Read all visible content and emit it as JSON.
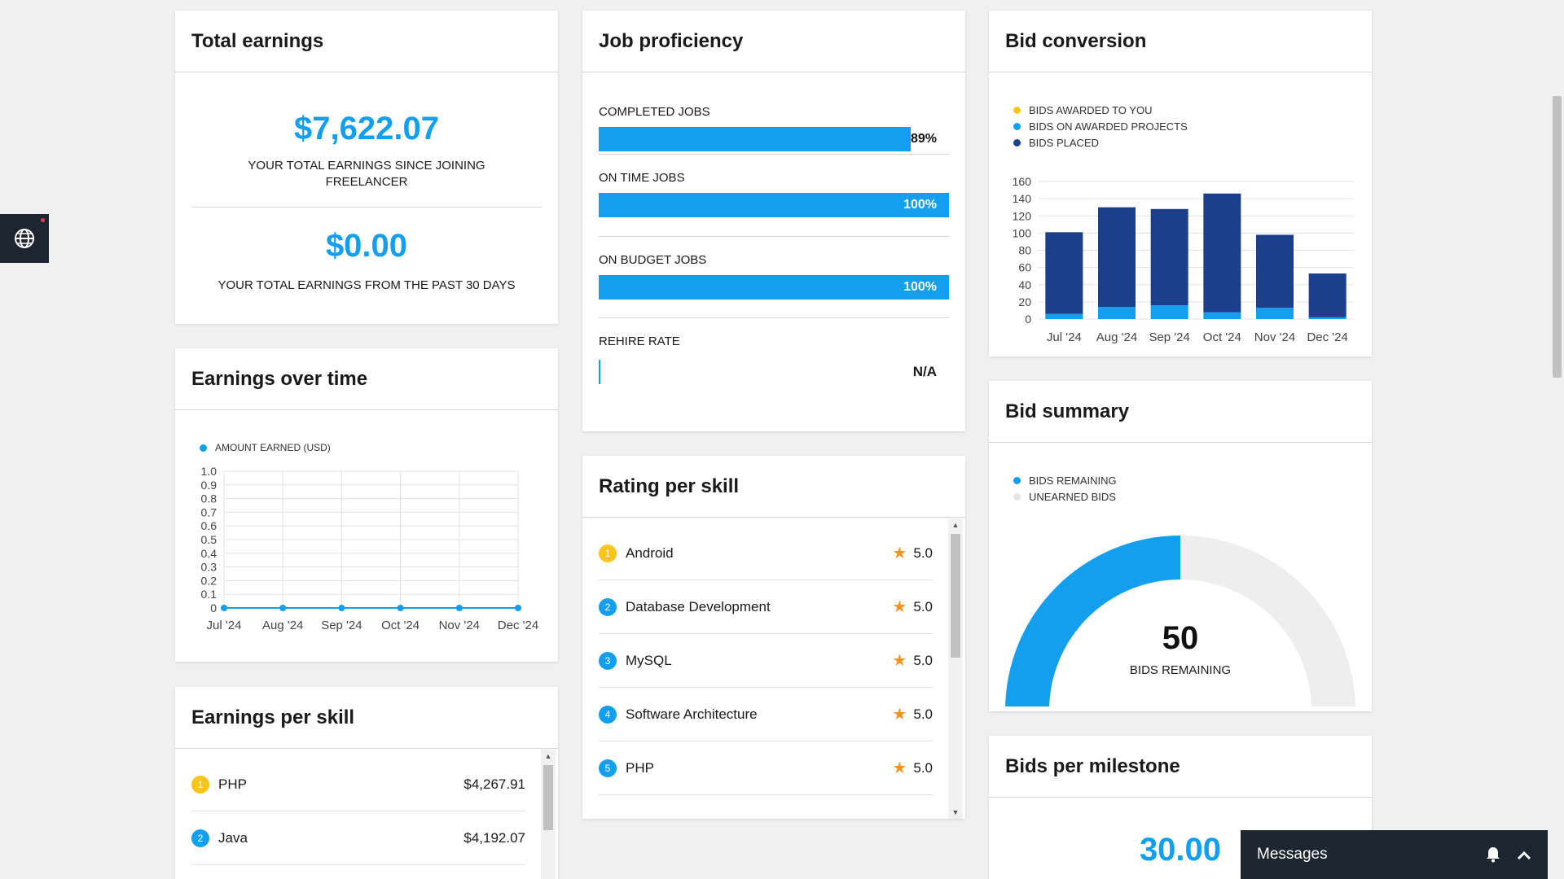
{
  "total_earnings": {
    "title": "Total earnings",
    "amount": "$7,622.07",
    "amount_caption_line1": "YOUR TOTAL EARNINGS SINCE JOINING",
    "amount_caption_line2": "FREELANCER",
    "recent_amount": "$0.00",
    "recent_caption": "YOUR TOTAL EARNINGS FROM THE PAST 30 DAYS"
  },
  "job_proficiency": {
    "title": "Job proficiency",
    "items": [
      {
        "label": "COMPLETED JOBS",
        "value": "89%",
        "fraction": 0.89
      },
      {
        "label": "ON TIME JOBS",
        "value": "100%",
        "fraction": 1.0
      },
      {
        "label": "ON BUDGET JOBS",
        "value": "100%",
        "fraction": 1.0
      }
    ],
    "rehire_label": "REHIRE RATE",
    "rehire_value": "N/A"
  },
  "bid_conversion": {
    "title": "Bid conversion",
    "legend": [
      "BIDS AWARDED TO YOU",
      "BIDS ON AWARDED PROJECTS",
      "BIDS PLACED"
    ],
    "colors": {
      "awarded": "#f9c51a",
      "on_awarded": "#139ff0",
      "placed": "#1c3f8c"
    }
  },
  "earnings_over_time": {
    "title": "Earnings over time",
    "legend": "AMOUNT EARNED (USD)"
  },
  "rating_per_skill": {
    "title": "Rating per skill",
    "items": [
      {
        "rank": "1",
        "skill": "Android",
        "rating": "5.0"
      },
      {
        "rank": "2",
        "skill": "Database Development",
        "rating": "5.0"
      },
      {
        "rank": "3",
        "skill": "MySQL",
        "rating": "5.0"
      },
      {
        "rank": "4",
        "skill": "Software Architecture",
        "rating": "5.0"
      },
      {
        "rank": "5",
        "skill": "PHP",
        "rating": "5.0"
      }
    ]
  },
  "bid_summary": {
    "title": "Bid summary",
    "legend": [
      "BIDS REMAINING",
      "UNEARNED BIDS"
    ],
    "remaining_value": "50",
    "remaining_caption": "BIDS REMAINING",
    "remaining_fraction": 0.5,
    "colors": {
      "remaining": "#139ff0",
      "unearned": "#eeeeee"
    }
  },
  "earnings_per_skill": {
    "title": "Earnings per skill",
    "items": [
      {
        "rank": "1",
        "skill": "PHP",
        "amount": "$4,267.91"
      },
      {
        "rank": "2",
        "skill": "Java",
        "amount": "$4,192.07"
      }
    ]
  },
  "bids_per_milestone": {
    "title": "Bids per milestone",
    "value": "30.00"
  },
  "messages": {
    "label": "Messages"
  },
  "side_widget": {
    "icon": "globe-icon"
  },
  "chart_data": [
    {
      "type": "bar",
      "stacked": true,
      "categories": [
        "Jul '24",
        "Aug '24",
        "Sep '24",
        "Oct '24",
        "Nov '24",
        "Dec '24"
      ],
      "series": [
        {
          "name": "BIDS AWARDED TO YOU",
          "values": [
            0,
            0,
            0,
            0,
            0,
            0
          ]
        },
        {
          "name": "BIDS ON AWARDED PROJECTS",
          "values": [
            6,
            14,
            16,
            8,
            13,
            2
          ]
        },
        {
          "name": "BIDS PLACED",
          "values": [
            95,
            116,
            112,
            138,
            85,
            51
          ]
        }
      ],
      "y_ticks": [
        "0",
        "20",
        "40",
        "60",
        "80",
        "100",
        "120",
        "140",
        "160"
      ],
      "ylim": [
        0,
        160
      ],
      "grid": true,
      "legend_position": "top-left"
    },
    {
      "type": "line",
      "x": [
        "Jul '24",
        "Aug '24",
        "Sep '24",
        "Oct '24",
        "Nov '24",
        "Dec '24"
      ],
      "series": [
        {
          "name": "AMOUNT EARNED (USD)",
          "values": [
            0,
            0,
            0,
            0,
            0,
            0
          ]
        }
      ],
      "y_ticks": [
        "0",
        "0.1",
        "0.2",
        "0.3",
        "0.4",
        "0.5",
        "0.6",
        "0.7",
        "0.8",
        "0.9",
        "1.0"
      ],
      "ylim": [
        0,
        1
      ],
      "grid": true,
      "legend_position": "top-left"
    }
  ]
}
